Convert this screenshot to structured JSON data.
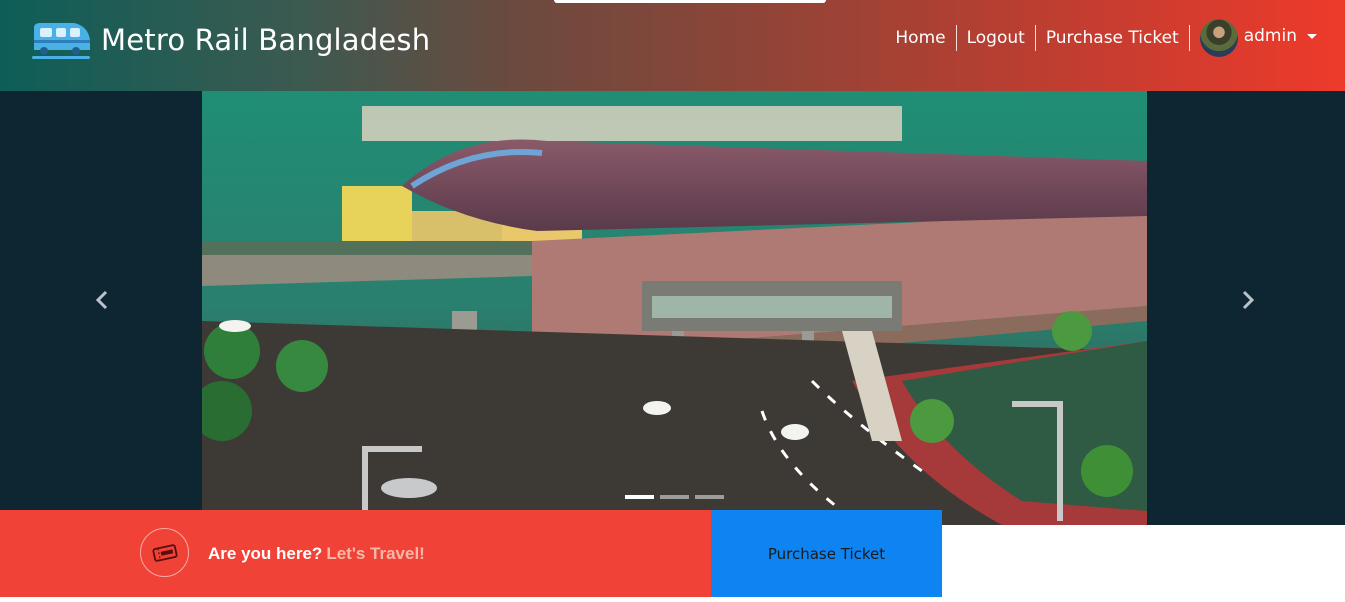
{
  "navbar": {
    "brand_text": "Metro Rail Bangladesh",
    "brand_icon": "train-icon",
    "links": [
      "Home",
      "Logout",
      "Purchase Ticket"
    ],
    "user": {
      "name": "admin",
      "avatar_icon": "user-avatar"
    },
    "gradient": [
      "#0d5e58",
      "#ee3a2b"
    ]
  },
  "carousel": {
    "slide_count": 3,
    "active_index": 0,
    "prev_icon": "chevron-left-icon",
    "next_icon": "chevron-right-icon"
  },
  "cta": {
    "question": "Are you here?",
    "accent": "Let's Travel!",
    "icon": "ticket-icon",
    "button_label": "Purchase Ticket",
    "colors": {
      "bar": "#f04236",
      "button": "#0d84f1"
    }
  }
}
